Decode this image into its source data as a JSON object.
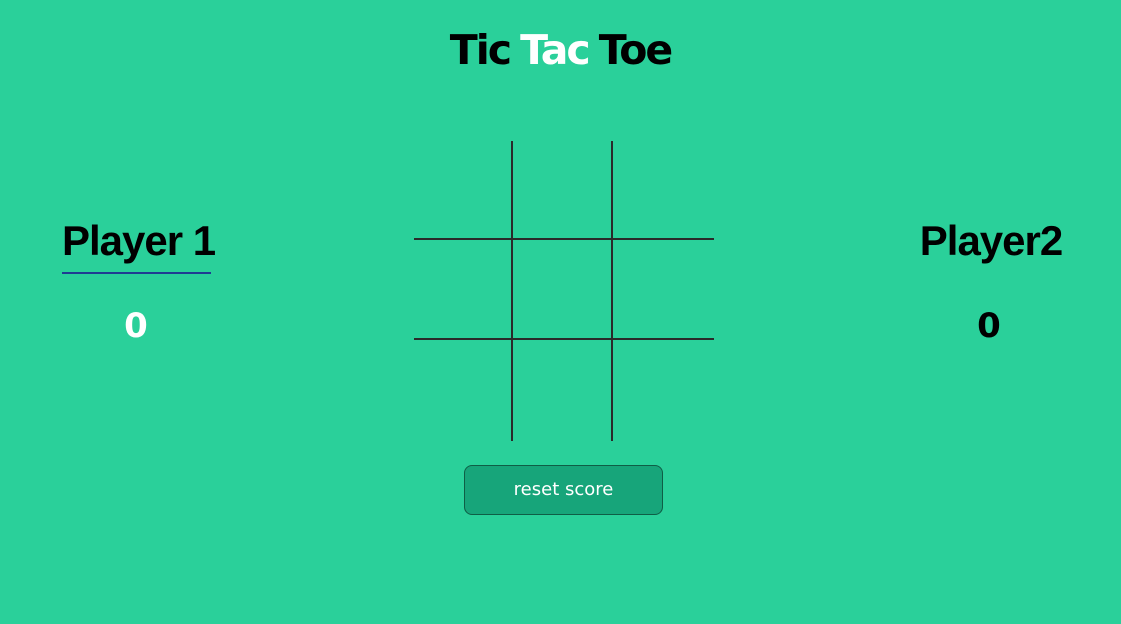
{
  "title": {
    "part1": "Tic",
    "part2": "Tac",
    "part3": "Toe"
  },
  "players": [
    {
      "name": "Player 1",
      "score": "0",
      "active": true,
      "score_color": "#ffffff"
    },
    {
      "name": "Player2",
      "score": "0",
      "active": false,
      "score_color": "#000000"
    }
  ],
  "board": {
    "cells": [
      "",
      "",
      "",
      "",
      "",
      "",
      "",
      "",
      ""
    ]
  },
  "reset_button": {
    "label": "reset score"
  },
  "colors": {
    "background": "#2ad09a",
    "accent": "#ffffff",
    "button": "#17a57a",
    "active_underline": "#1f3c92"
  }
}
